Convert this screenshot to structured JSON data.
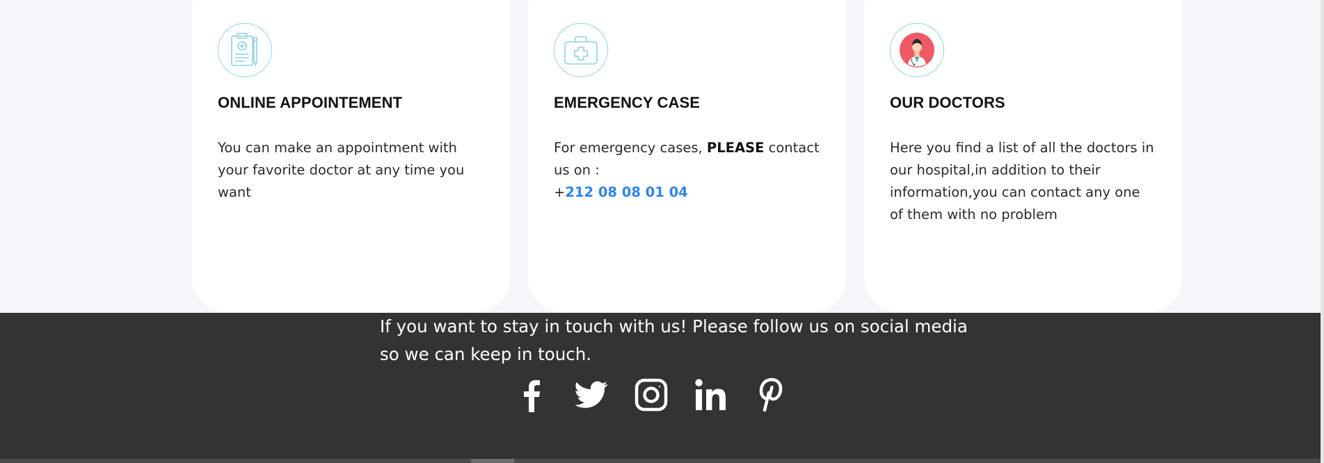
{
  "cards": [
    {
      "icon": "clipboard-medical-icon",
      "title": "ONLINE APPOINTEMENT",
      "text": "You can make an appointment with your favorite doctor at any time you want"
    },
    {
      "icon": "first-aid-kit-icon",
      "title": "EMERGENCY CASE",
      "text_before": "For emergency cases, ",
      "text_bold": "PLEASE",
      "text_after": " contact us on :",
      "phone_prefix": "+",
      "phone": "212 08 08 01 04"
    },
    {
      "icon": "doctor-avatar-icon",
      "title": "OUR DOCTORS",
      "text": "Here you find a list of all the  doctors in our hospital,in addition to their information,you can contact any one of them with no problem"
    }
  ],
  "footer": {
    "text": "If you want to stay in touch with us! Please follow us on social media so we can keep in touch.",
    "socials": [
      "facebook-icon",
      "twitter-icon",
      "instagram-icon",
      "linkedin-icon",
      "pinterest-icon"
    ]
  },
  "colors": {
    "accent": "#2f86e6",
    "icon_outline": "#8fd2dc",
    "footer_bg": "#333333",
    "page_bg": "#f5f6fa"
  }
}
